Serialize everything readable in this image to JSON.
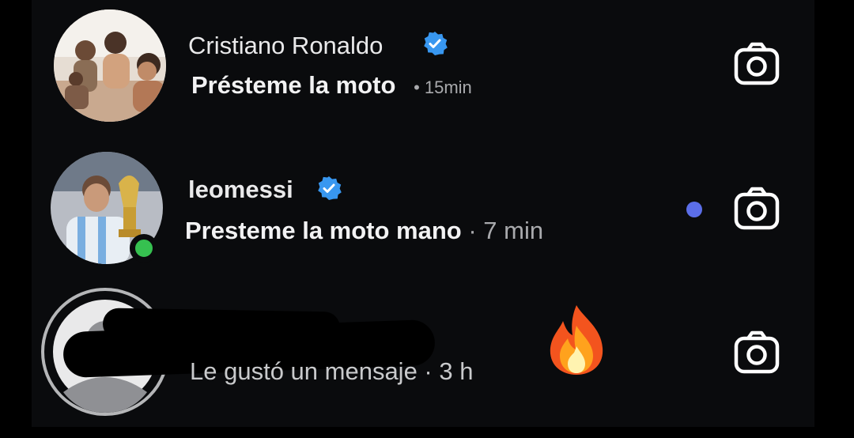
{
  "conversations": [
    {
      "username": "Cristiano Ronaldo",
      "verified": true,
      "message": "Présteme la moto",
      "time": "• 15min",
      "unread": false,
      "online": false,
      "avatar_icon": "family-photo-avatar",
      "action_icon": "camera-icon"
    },
    {
      "username": "leomessi",
      "verified": true,
      "message": "Presteme la moto mano",
      "time": " · 7 min",
      "unread": true,
      "online": true,
      "avatar_icon": "trophy-photo-avatar",
      "action_icon": "camera-icon"
    },
    {
      "username": "",
      "verified": false,
      "message": "Le gustó un mensaje · 3 h",
      "time": "",
      "unread": false,
      "online": false,
      "avatar_icon": "default-avatar",
      "action_icon": "camera-icon",
      "sticker": "fire-emoji"
    }
  ],
  "colors": {
    "background": "#0a0b0d",
    "verified_badge": "#3897f0",
    "unread_dot": "#5b6ee8",
    "online_dot": "#36c150"
  }
}
